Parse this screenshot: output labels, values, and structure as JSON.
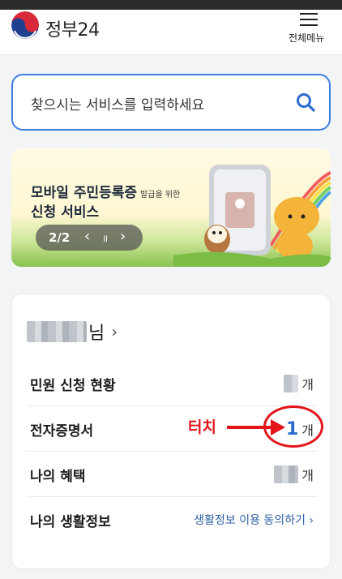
{
  "header": {
    "logo_text": "정부24",
    "menu_label": "전체메뉴"
  },
  "search": {
    "placeholder": "찾으시는 서비스를 입력하세요"
  },
  "banner": {
    "title_line1": "모바일 주민등록증",
    "title_line1_small": "발급을 위한",
    "title_line2": "신청 서비스",
    "page_indicator": "2/2",
    "prev_symbol": "‹",
    "pause_symbol": "॥",
    "next_symbol": "›"
  },
  "profile": {
    "name_suffix": "님",
    "arrow": "›"
  },
  "rows": [
    {
      "label": "민원 신청 현황",
      "unit": "개"
    },
    {
      "label": "전자증명서",
      "count": "1",
      "unit": "개"
    },
    {
      "label": "나의 혜택",
      "unit": "개"
    },
    {
      "label": "나의 생활정보",
      "link": "생활정보 이용 동의하기 ›"
    }
  ],
  "annotation": {
    "text": "터치",
    "color": "#e3151b"
  },
  "colors": {
    "accent": "#3f7fe0",
    "count": "#2c6bd1",
    "link": "#2d5fa6"
  }
}
